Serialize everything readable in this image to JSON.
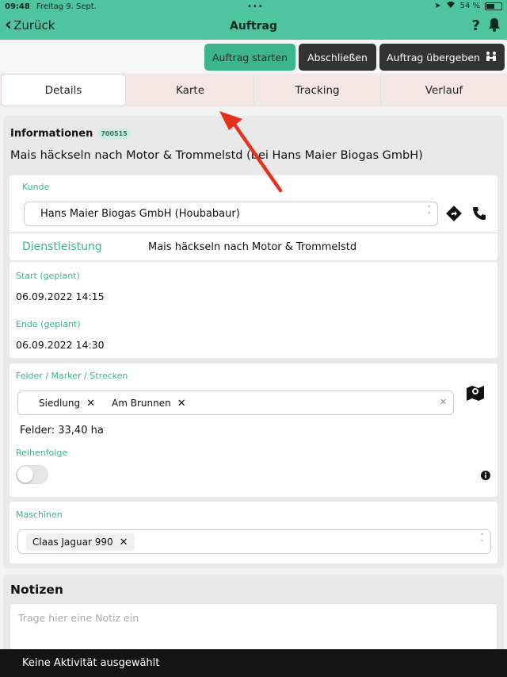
{
  "status_bar": {
    "time": "09:48",
    "date": "Freitag 9. Sept.",
    "battery": "54 %",
    "battery_level": 0.54,
    "icons": [
      "location-icon",
      "wifi-icon",
      "battery-icon"
    ]
  },
  "nav": {
    "back_label": "Zurück",
    "title": "Auftrag",
    "icons": [
      "help-icon",
      "bell-icon"
    ]
  },
  "toolbar": {
    "start_label": "Auftrag starten",
    "close_label": "Abschließen",
    "handover_label": "Auftrag übergeben"
  },
  "tabs": [
    {
      "label": "Details",
      "active": true
    },
    {
      "label": "Karte",
      "active": false
    },
    {
      "label": "Tracking",
      "active": false
    },
    {
      "label": "Verlauf",
      "active": false
    }
  ],
  "info": {
    "heading": "Informationen",
    "badge": "700515",
    "title": "Mais häckseln nach Motor & Trommelstd (bei Hans Maier Biogas GmbH)"
  },
  "customer": {
    "label": "Kunde",
    "value": "Hans Maier Biogas GmbH (Houbabaur)"
  },
  "service": {
    "label": "Dienstleistung",
    "value": "Mais häckseln nach Motor & Trommelstd"
  },
  "schedule": {
    "start_label": "Start (geplant)",
    "start_value": "06.09.2022 14:15",
    "end_label": "Ende (geplant)",
    "end_value": "06.09.2022 14:30"
  },
  "fields": {
    "label": "Felder / Marker / Strecken",
    "chips": [
      "Siedlung",
      "Am Brunnen"
    ],
    "summary": "Felder: 33,40 ha",
    "order_label": "Reihenfolge",
    "order_enabled": false
  },
  "machines": {
    "label": "Maschinen",
    "chips": [
      "Claas Jaguar 990"
    ]
  },
  "notes": {
    "title": "Notizen",
    "placeholder": "Trage hier eine Notiz ein"
  },
  "bottom": {
    "status": "Keine Aktivität ausgewählt"
  },
  "colors": {
    "accent": "#4ec49f",
    "button_primary": "#3cb58d",
    "button_dark": "#333333",
    "annotation_arrow": "#e8301e"
  }
}
